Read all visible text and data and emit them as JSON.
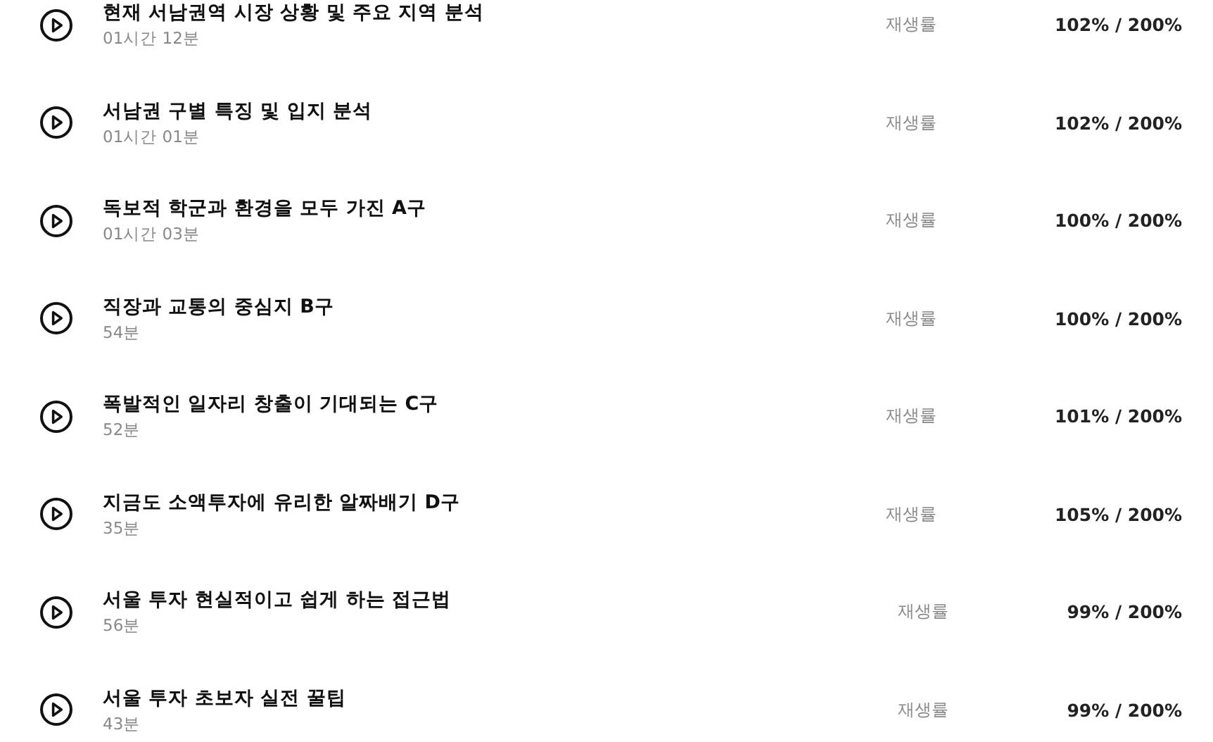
{
  "lessons": [
    {
      "title": "현재 서남권역 시장 상황 및 주요 지역 분석",
      "duration": "01시간 12분",
      "rate_label": "재생률",
      "rate": "102% / 200%"
    },
    {
      "title": "서남권 구별 특징 및 입지 분석",
      "duration": "01시간 01분",
      "rate_label": "재생률",
      "rate": "102% / 200%"
    },
    {
      "title": "독보적 학군과 환경을 모두 가진 A구",
      "duration": "01시간 03분",
      "rate_label": "재생률",
      "rate": "100% / 200%"
    },
    {
      "title": "직장과 교통의 중심지 B구",
      "duration": "54분",
      "rate_label": "재생률",
      "rate": "100% / 200%"
    },
    {
      "title": "폭발적인 일자리 창출이 기대되는 C구",
      "duration": "52분",
      "rate_label": "재생률",
      "rate": "101% / 200%"
    },
    {
      "title": "지금도 소액투자에 유리한 알짜배기 D구",
      "duration": "35분",
      "rate_label": "재생률",
      "rate": "105% / 200%"
    },
    {
      "title": "서울 투자 현실적이고 쉽게 하는 접근법",
      "duration": "56분",
      "rate_label": "재생률",
      "rate": "99% / 200%"
    },
    {
      "title": "서울 투자 초보자 실전 꿀팁",
      "duration": "43분",
      "rate_label": "재생률",
      "rate": "99% / 200%"
    }
  ]
}
